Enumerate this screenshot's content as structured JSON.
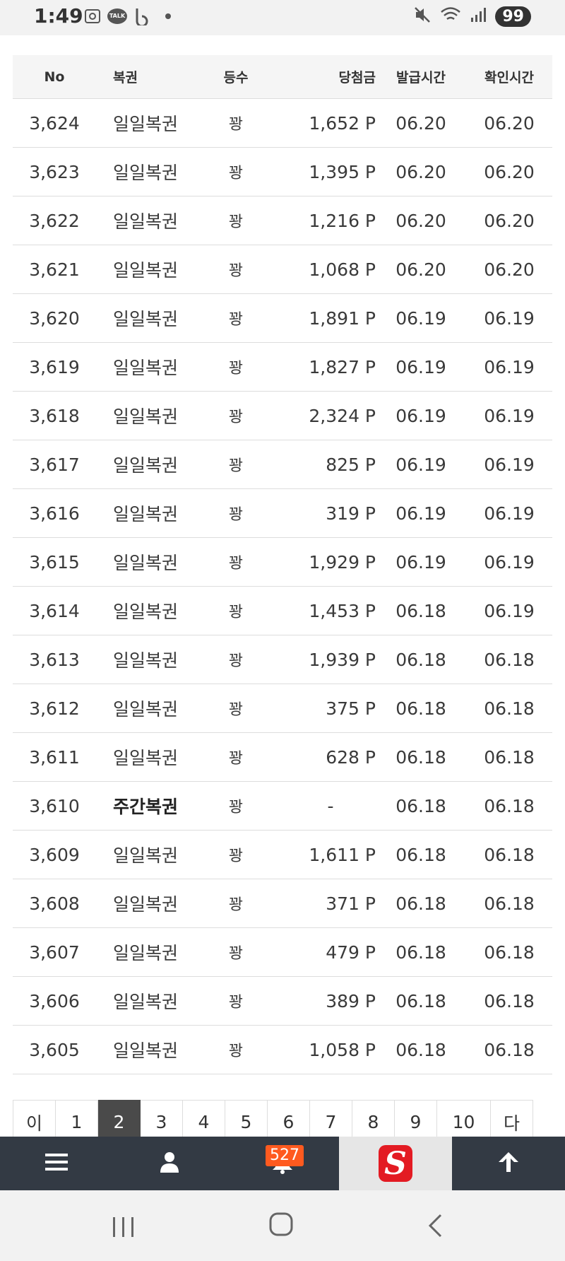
{
  "status_bar": {
    "time": "1:49",
    "talk_label": "TALK",
    "battery": "99"
  },
  "table": {
    "headers": {
      "no": "No",
      "name": "복권",
      "rank": "등수",
      "prize": "당첨금",
      "issue": "발급시간",
      "check": "확인시간"
    },
    "rows": [
      {
        "no": "3,624",
        "name": "일일복권",
        "rank": "꽝",
        "prize": "1,652 P",
        "issue": "06.20",
        "check": "06.20"
      },
      {
        "no": "3,623",
        "name": "일일복권",
        "rank": "꽝",
        "prize": "1,395 P",
        "issue": "06.20",
        "check": "06.20"
      },
      {
        "no": "3,622",
        "name": "일일복권",
        "rank": "꽝",
        "prize": "1,216 P",
        "issue": "06.20",
        "check": "06.20"
      },
      {
        "no": "3,621",
        "name": "일일복권",
        "rank": "꽝",
        "prize": "1,068 P",
        "issue": "06.20",
        "check": "06.20"
      },
      {
        "no": "3,620",
        "name": "일일복권",
        "rank": "꽝",
        "prize": "1,891 P",
        "issue": "06.19",
        "check": "06.19"
      },
      {
        "no": "3,619",
        "name": "일일복권",
        "rank": "꽝",
        "prize": "1,827 P",
        "issue": "06.19",
        "check": "06.19"
      },
      {
        "no": "3,618",
        "name": "일일복권",
        "rank": "꽝",
        "prize": "2,324 P",
        "issue": "06.19",
        "check": "06.19"
      },
      {
        "no": "3,617",
        "name": "일일복권",
        "rank": "꽝",
        "prize": "825 P",
        "issue": "06.19",
        "check": "06.19"
      },
      {
        "no": "3,616",
        "name": "일일복권",
        "rank": "꽝",
        "prize": "319 P",
        "issue": "06.19",
        "check": "06.19"
      },
      {
        "no": "3,615",
        "name": "일일복권",
        "rank": "꽝",
        "prize": "1,929 P",
        "issue": "06.19",
        "check": "06.19"
      },
      {
        "no": "3,614",
        "name": "일일복권",
        "rank": "꽝",
        "prize": "1,453 P",
        "issue": "06.18",
        "check": "06.19"
      },
      {
        "no": "3,613",
        "name": "일일복권",
        "rank": "꽝",
        "prize": "1,939 P",
        "issue": "06.18",
        "check": "06.18"
      },
      {
        "no": "3,612",
        "name": "일일복권",
        "rank": "꽝",
        "prize": "375 P",
        "issue": "06.18",
        "check": "06.18"
      },
      {
        "no": "3,611",
        "name": "일일복권",
        "rank": "꽝",
        "prize": "628 P",
        "issue": "06.18",
        "check": "06.18"
      },
      {
        "no": "3,610",
        "name": "주간복권",
        "rank": "꽝",
        "prize": "-",
        "issue": "06.18",
        "check": "06.18",
        "bold": true
      },
      {
        "no": "3,609",
        "name": "일일복권",
        "rank": "꽝",
        "prize": "1,611 P",
        "issue": "06.18",
        "check": "06.18"
      },
      {
        "no": "3,608",
        "name": "일일복권",
        "rank": "꽝",
        "prize": "371 P",
        "issue": "06.18",
        "check": "06.18"
      },
      {
        "no": "3,607",
        "name": "일일복권",
        "rank": "꽝",
        "prize": "479 P",
        "issue": "06.18",
        "check": "06.18"
      },
      {
        "no": "3,606",
        "name": "일일복권",
        "rank": "꽝",
        "prize": "389 P",
        "issue": "06.18",
        "check": "06.18"
      },
      {
        "no": "3,605",
        "name": "일일복권",
        "rank": "꽝",
        "prize": "1,058 P",
        "issue": "06.18",
        "check": "06.18"
      }
    ]
  },
  "pagination": {
    "prev": "이",
    "pages": [
      "1",
      "2",
      "3",
      "4",
      "5",
      "6",
      "7",
      "8",
      "9",
      "10"
    ],
    "active": "2",
    "next": "다"
  },
  "bottom_nav": {
    "notification_count": "527",
    "icons": [
      "menu-icon",
      "user-icon",
      "bell-icon",
      "logo",
      "arrow-up-icon"
    ]
  },
  "colors": {
    "nav_bg": "#333a44",
    "badge": "#ff5a1f",
    "logo_red": "#e31b23",
    "active_page": "#4a4a4a"
  }
}
